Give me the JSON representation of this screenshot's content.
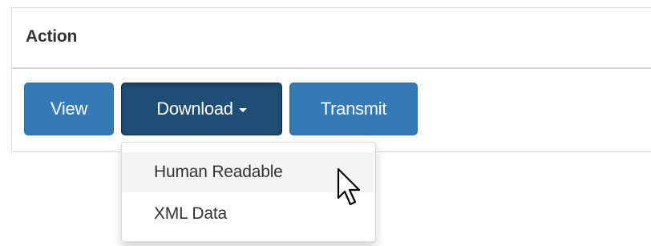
{
  "table": {
    "header": {
      "action_label": "Action"
    }
  },
  "buttons": {
    "view_label": "View",
    "download_label": "Download",
    "transmit_label": "Transmit"
  },
  "dropdown": {
    "items": [
      {
        "label": "Human Readable",
        "hovered": true
      },
      {
        "label": "XML Data",
        "hovered": false
      }
    ]
  },
  "colors": {
    "primary": "#337ab7",
    "primary_active": "#204d74",
    "menu_hover_bg": "#f5f5f5",
    "border": "#dddddd"
  },
  "icons": {
    "caret": "caret-down-icon",
    "cursor": "mouse-pointer-icon"
  }
}
